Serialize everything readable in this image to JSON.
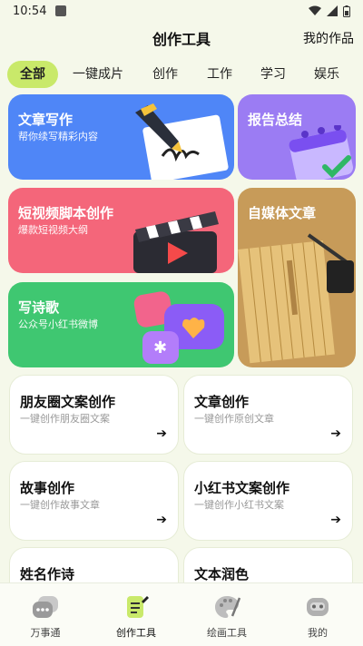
{
  "status_bar": {
    "time": "10:54"
  },
  "header": {
    "title": "创作工具",
    "my_works": "我的作品"
  },
  "tabs": [
    {
      "label": "全部",
      "active": true
    },
    {
      "label": "一键成片"
    },
    {
      "label": "创作"
    },
    {
      "label": "工作"
    },
    {
      "label": "学习"
    },
    {
      "label": "娱乐"
    }
  ],
  "feature_cards": [
    {
      "title": "文章写作",
      "subtitle": "帮你续写精彩内容",
      "color": "#4f86f7",
      "icon": "pen-paper-icon"
    },
    {
      "title": "报告总结",
      "subtitle": "",
      "color": "#9b7cf3",
      "icon": "calendar-icon"
    },
    {
      "title": "短视频脚本创作",
      "subtitle": "爆款短视频大纲",
      "color": "#f4667a",
      "icon": "clapperboard-icon"
    },
    {
      "title": "自媒体文章",
      "subtitle": "",
      "color": "#c79b59",
      "icon": "bamboo-scroll-icon"
    },
    {
      "title": "写诗歌",
      "subtitle": "公众号小红书微博",
      "color": "#3fc771",
      "icon": "chat-bubbles-icon"
    }
  ],
  "tool_cards": [
    {
      "title": "朋友圈文案创作",
      "subtitle": "一键创作朋友圈文案"
    },
    {
      "title": "文章创作",
      "subtitle": "一键创作原创文章"
    },
    {
      "title": "故事创作",
      "subtitle": "一键创作故事文章"
    },
    {
      "title": "小红书文案创作",
      "subtitle": "一键创作小红书文案"
    },
    {
      "title": "姓名作诗",
      "subtitle": ""
    },
    {
      "title": "文本润色",
      "subtitle": ""
    }
  ],
  "arrow_glyph": "➔",
  "bottom_nav": [
    {
      "label": "万事通",
      "icon": "chat-icon"
    },
    {
      "label": "创作工具",
      "icon": "document-pen-icon",
      "active": true
    },
    {
      "label": "绘画工具",
      "icon": "palette-icon"
    },
    {
      "label": "我的",
      "icon": "robot-icon"
    }
  ]
}
